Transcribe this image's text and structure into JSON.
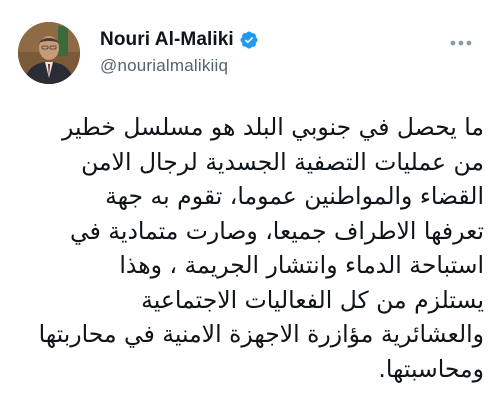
{
  "author": {
    "display_name": "Nouri Al-Maliki",
    "handle": "@nourialmalikiiq",
    "verified": true
  },
  "icons": {
    "verified": "verified-badge-icon",
    "more": "more-options-icon"
  },
  "colors": {
    "text": "#0f1419",
    "secondary": "#536471",
    "verified_blue": "#1d9bf0",
    "more_dots": "#8b98a5"
  },
  "tweet": {
    "lines": [
      "ما يحصل في جنوبي البلد هو مسلسل خطير",
      "من عمليات التصفية الجسدية لرجال الامن",
      "القضاء والمواطنين عموما، تقوم به جهة",
      "تعرفها الاطراف جميعا، وصارت متمادية في",
      "استباحة الدماء وانتشار الجريمة ، وهذا",
      "يستلزم من كل الفعاليات الاجتماعية",
      "والعشائرية مؤازرة الاجهزة الامنية في محاربتها",
      "ومحاسبتها."
    ]
  }
}
